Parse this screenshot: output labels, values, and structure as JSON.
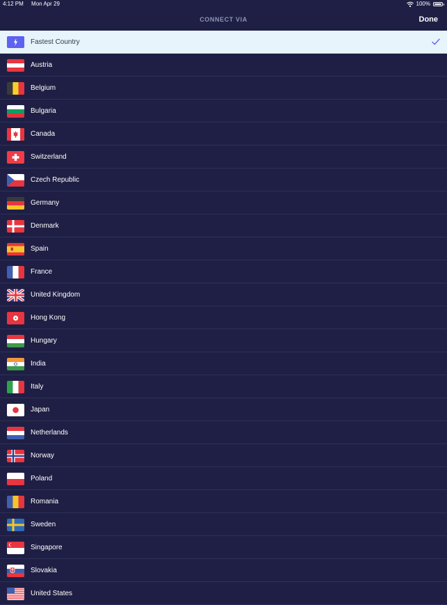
{
  "status_bar": {
    "time": "4:12 PM",
    "date": "Mon Apr 29",
    "battery": "100%"
  },
  "nav": {
    "title": "CONNECT VIA",
    "done_label": "Done"
  },
  "fastest": {
    "label": "Fastest Country",
    "selected": true
  },
  "countries": [
    {
      "label": "Austria",
      "icon": "flag-austria-icon"
    },
    {
      "label": "Belgium",
      "icon": "flag-belgium-icon"
    },
    {
      "label": "Bulgaria",
      "icon": "flag-bulgaria-icon"
    },
    {
      "label": "Canada",
      "icon": "flag-canada-icon"
    },
    {
      "label": "Switzerland",
      "icon": "flag-switzerland-icon"
    },
    {
      "label": "Czech Republic",
      "icon": "flag-czech-republic-icon"
    },
    {
      "label": "Germany",
      "icon": "flag-germany-icon"
    },
    {
      "label": "Denmark",
      "icon": "flag-denmark-icon"
    },
    {
      "label": "Spain",
      "icon": "flag-spain-icon"
    },
    {
      "label": "France",
      "icon": "flag-france-icon"
    },
    {
      "label": "United Kingdom",
      "icon": "flag-united-kingdom-icon"
    },
    {
      "label": "Hong Kong",
      "icon": "flag-hong-kong-icon"
    },
    {
      "label": "Hungary",
      "icon": "flag-hungary-icon"
    },
    {
      "label": "India",
      "icon": "flag-india-icon"
    },
    {
      "label": "Italy",
      "icon": "flag-italy-icon"
    },
    {
      "label": "Japan",
      "icon": "flag-japan-icon"
    },
    {
      "label": "Netherlands",
      "icon": "flag-netherlands-icon"
    },
    {
      "label": "Norway",
      "icon": "flag-norway-icon"
    },
    {
      "label": "Poland",
      "icon": "flag-poland-icon"
    },
    {
      "label": "Romania",
      "icon": "flag-romania-icon"
    },
    {
      "label": "Sweden",
      "icon": "flag-sweden-icon"
    },
    {
      "label": "Singapore",
      "icon": "flag-singapore-icon"
    },
    {
      "label": "Slovakia",
      "icon": "flag-slovakia-icon"
    },
    {
      "label": "United States",
      "icon": "flag-united-states-icon"
    }
  ],
  "colors": {
    "background": "#1f1f45",
    "selected_row": "#e7f4fb",
    "accent": "#5d62f0",
    "check": "#5d62f0",
    "title": "#8e93b4"
  }
}
